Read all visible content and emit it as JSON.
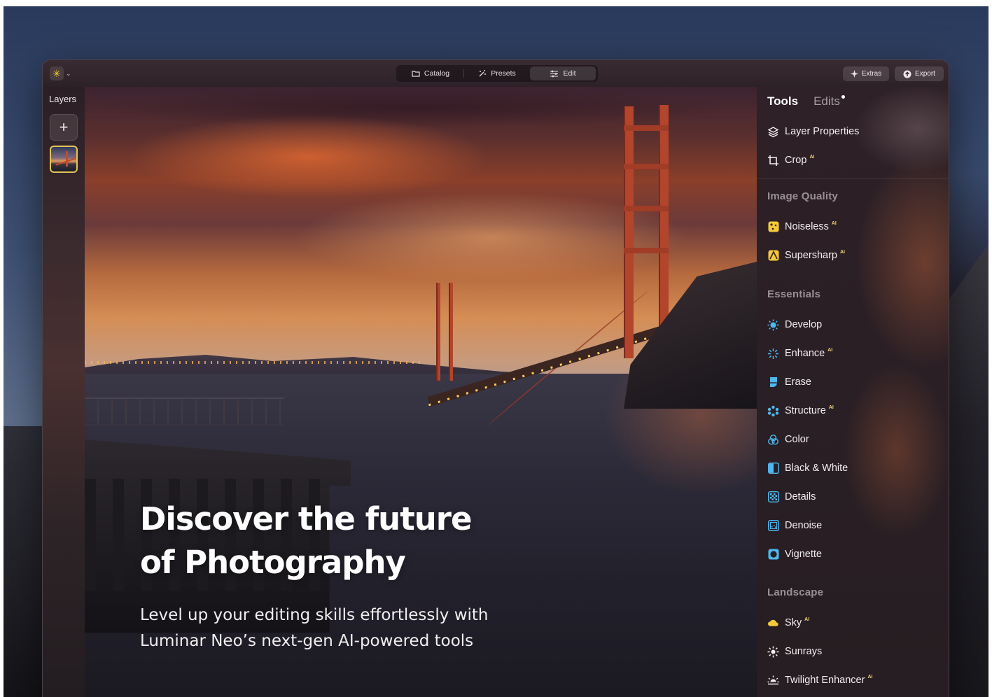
{
  "titlebar": {
    "tabs": [
      {
        "label": "Catalog",
        "icon": "folder-icon"
      },
      {
        "label": "Presets",
        "icon": "magic-wand-icon"
      },
      {
        "label": "Edit",
        "icon": "sliders-icon"
      }
    ],
    "active_tab": "Edit",
    "extras_label": "Extras",
    "export_label": "Export"
  },
  "layers": {
    "title": "Layers",
    "add_label": "+"
  },
  "hero": {
    "title_line1": "Discover the future",
    "title_line2": "of Photography",
    "subtitle_line1": "Level up your editing skills effortlessly with",
    "subtitle_line2": "Luminar Neo’s next-gen AI-powered tools"
  },
  "tools": {
    "tab_tools": "Tools",
    "tab_edits": "Edits",
    "ai_badge": "AI",
    "top_items": [
      {
        "label": "Layer Properties",
        "icon": "layers-icon",
        "ai": false
      },
      {
        "label": "Crop",
        "icon": "crop-icon",
        "ai": true
      }
    ],
    "sections": [
      {
        "title": "Image Quality",
        "items": [
          {
            "label": "Noiseless",
            "icon": "noiseless-icon",
            "ai": true
          },
          {
            "label": "Supersharp",
            "icon": "supersharp-icon",
            "ai": true
          }
        ]
      },
      {
        "title": "Essentials",
        "items": [
          {
            "label": "Develop",
            "icon": "develop-icon",
            "ai": false
          },
          {
            "label": "Enhance",
            "icon": "enhance-icon",
            "ai": true
          },
          {
            "label": "Erase",
            "icon": "erase-icon",
            "ai": false
          },
          {
            "label": "Structure",
            "icon": "structure-icon",
            "ai": true
          },
          {
            "label": "Color",
            "icon": "color-icon",
            "ai": false
          },
          {
            "label": "Black & White",
            "icon": "black-white-icon",
            "ai": false
          },
          {
            "label": "Details",
            "icon": "details-icon",
            "ai": false
          },
          {
            "label": "Denoise",
            "icon": "denoise-icon",
            "ai": false
          },
          {
            "label": "Vignette",
            "icon": "vignette-icon",
            "ai": false
          }
        ]
      },
      {
        "title": "Landscape",
        "items": [
          {
            "label": "Sky",
            "icon": "sky-icon",
            "ai": true
          },
          {
            "label": "Sunrays",
            "icon": "sunrays-icon",
            "ai": false
          },
          {
            "label": "Twilight Enhancer",
            "icon": "twilight-icon",
            "ai": true
          }
        ]
      }
    ]
  },
  "colors": {
    "accent_yellow": "#f5c93a",
    "accent_blue": "#4fb8f0",
    "panel_bg": "#2a1f25"
  }
}
